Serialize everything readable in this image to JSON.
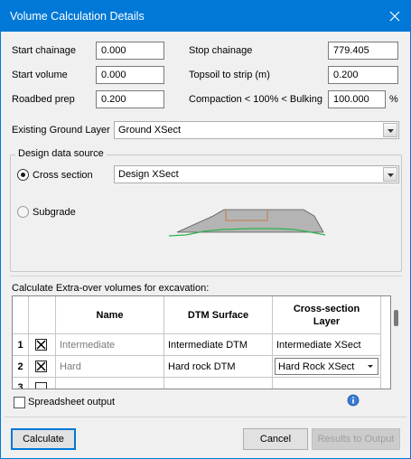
{
  "window": {
    "title": "Volume Calculation Details"
  },
  "fields": {
    "start_chainage": {
      "label": "Start chainage",
      "value": "0.000"
    },
    "stop_chainage": {
      "label": "Stop chainage",
      "value": "779.405"
    },
    "start_volume": {
      "label": "Start volume",
      "value": "0.000"
    },
    "topsoil": {
      "label": "Topsoil to strip (m)",
      "value": "0.200"
    },
    "roadbed": {
      "label": "Roadbed prep",
      "value": "0.200"
    },
    "compaction": {
      "label": "Compaction < 100% < Bulking",
      "value": "100.000",
      "unit": "%"
    }
  },
  "existing_ground": {
    "label": "Existing Ground Layer",
    "value": "Ground XSect"
  },
  "design_source": {
    "title": "Design data source",
    "cross_section": {
      "label": "Cross section",
      "selected": true,
      "layer": "Design XSect"
    },
    "subgrade": {
      "label": "Subgrade",
      "selected": false
    }
  },
  "extra_over": {
    "label": "Calculate Extra-over volumes for excavation:",
    "headers": {
      "name": "Name",
      "dtm": "DTM Surface",
      "layer": "Cross-section Layer"
    },
    "rows": [
      {
        "num": "1",
        "checked": true,
        "name": "Intermediate",
        "dtm": "Intermediate DTM",
        "layer": "Intermediate XSect"
      },
      {
        "num": "2",
        "checked": true,
        "name": "Hard",
        "dtm": "Hard rock DTM",
        "layer": "Hard Rock XSect"
      },
      {
        "num": "3",
        "checked": false,
        "name": "",
        "dtm": "",
        "layer": ""
      }
    ]
  },
  "spreadsheet": {
    "label": "Spreadsheet output",
    "checked": false
  },
  "buttons": {
    "calculate": "Calculate",
    "cancel": "Cancel",
    "results": "Results to Output"
  },
  "colors": {
    "accent": "#0078d7",
    "ground_line": "#2db34a",
    "road_fill": "#b4b4b4",
    "road_edge": "#c9774a"
  }
}
